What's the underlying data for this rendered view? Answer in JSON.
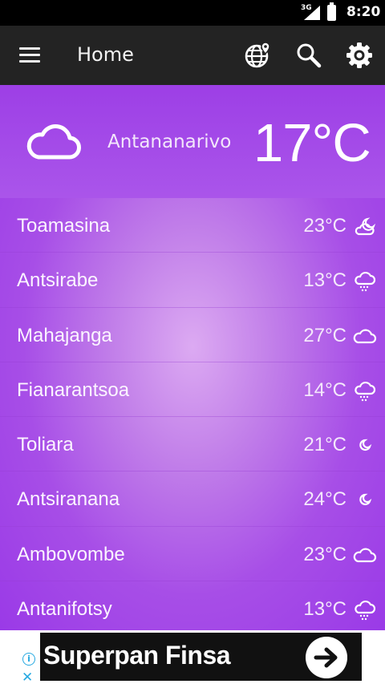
{
  "status_bar": {
    "network": "3G",
    "time": "8:20"
  },
  "toolbar": {
    "title": "Home",
    "icons": [
      "menu-icon",
      "globe-pin-icon",
      "search-icon",
      "gear-icon"
    ]
  },
  "current": {
    "city": "Antananarivo",
    "temperature": "17°C",
    "icon": "cloud-icon"
  },
  "cities": [
    {
      "name": "Toamasina",
      "temp": "23°C",
      "icon": "cloud-night-icon"
    },
    {
      "name": "Antsirabe",
      "temp": "13°C",
      "icon": "rain-cloud-icon"
    },
    {
      "name": "Mahajanga",
      "temp": "27°C",
      "icon": "cloud-icon"
    },
    {
      "name": "Fianarantsoa",
      "temp": "14°C",
      "icon": "rain-cloud-icon"
    },
    {
      "name": "Toliara",
      "temp": "21°C",
      "icon": "moon-icon"
    },
    {
      "name": "Antsiranana",
      "temp": "24°C",
      "icon": "moon-icon"
    },
    {
      "name": "Ambovombe",
      "temp": "23°C",
      "icon": "cloud-icon"
    },
    {
      "name": "Antanifotsy",
      "temp": "13°C",
      "icon": "rain-cloud-icon"
    }
  ],
  "ad": {
    "title": "Superpan Finsa",
    "info_icon": "info-icon",
    "close_icon": "close-icon",
    "arrow_icon": "arrow-right-icon"
  },
  "colors": {
    "toolbar": "#232323",
    "gradient_edge": "#9a3ae7",
    "gradient_center": "#dcaaf2",
    "ad_accent": "#27a9e1"
  }
}
